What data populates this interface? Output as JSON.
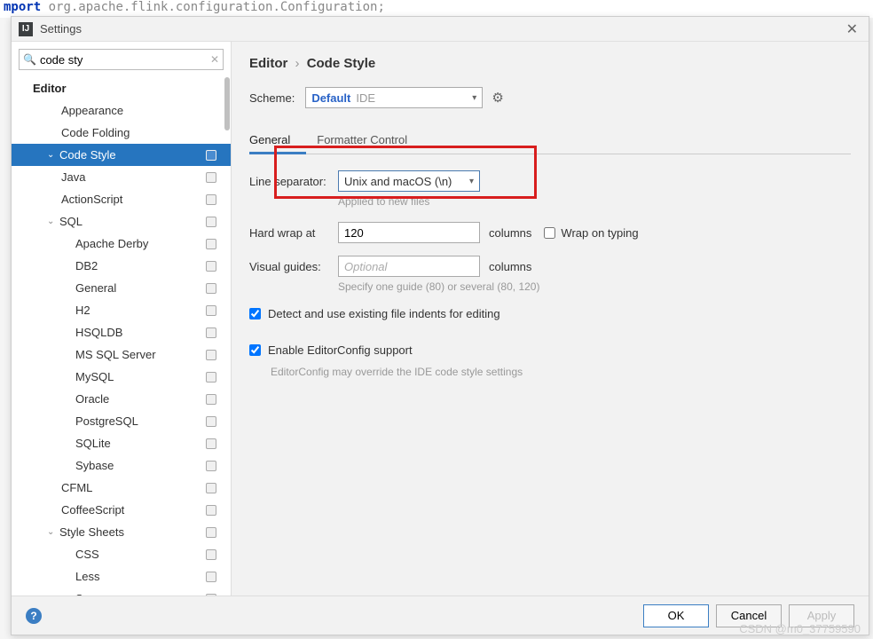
{
  "code_bg": {
    "keyword": "mport",
    "rest": " org.apache.flink.configuration.Configuration;"
  },
  "window": {
    "title": "Settings"
  },
  "search": {
    "value": "code sty"
  },
  "sidebar": {
    "header": "Editor",
    "items": [
      {
        "label": "Appearance",
        "cls": "pad-1",
        "scope": false
      },
      {
        "label": "Code Folding",
        "cls": "pad-1",
        "scope": false
      },
      {
        "label": "Code Style",
        "cls": "pad-2 selected",
        "expand": "⌄",
        "scope": true
      },
      {
        "label": "Java",
        "cls": "pad-1",
        "scope": true
      },
      {
        "label": "ActionScript",
        "cls": "pad-1",
        "scope": true
      },
      {
        "label": "SQL",
        "cls": "pad-2",
        "expand": "⌄",
        "scope": true
      },
      {
        "label": "Apache Derby",
        "cls": "pad-3",
        "scope": true
      },
      {
        "label": "DB2",
        "cls": "pad-3",
        "scope": true
      },
      {
        "label": "General",
        "cls": "pad-3",
        "scope": true
      },
      {
        "label": "H2",
        "cls": "pad-3",
        "scope": true
      },
      {
        "label": "HSQLDB",
        "cls": "pad-3",
        "scope": true
      },
      {
        "label": "MS SQL Server",
        "cls": "pad-3",
        "scope": true
      },
      {
        "label": "MySQL",
        "cls": "pad-3",
        "scope": true
      },
      {
        "label": "Oracle",
        "cls": "pad-3",
        "scope": true
      },
      {
        "label": "PostgreSQL",
        "cls": "pad-3",
        "scope": true
      },
      {
        "label": "SQLite",
        "cls": "pad-3",
        "scope": true
      },
      {
        "label": "Sybase",
        "cls": "pad-3",
        "scope": true
      },
      {
        "label": "CFML",
        "cls": "pad-1",
        "scope": true
      },
      {
        "label": "CoffeeScript",
        "cls": "pad-1",
        "scope": true
      },
      {
        "label": "Style Sheets",
        "cls": "pad-2",
        "expand": "⌄",
        "scope": true
      },
      {
        "label": "CSS",
        "cls": "pad-3",
        "scope": true
      },
      {
        "label": "Less",
        "cls": "pad-3",
        "scope": true
      },
      {
        "label": "Sass",
        "cls": "pad-3",
        "scope": true
      }
    ]
  },
  "breadcrumb": {
    "p1": "Editor",
    "sep": "›",
    "p2": "Code Style"
  },
  "scheme": {
    "label": "Scheme:",
    "value_main": "Default",
    "value_sub": "IDE"
  },
  "tabs": {
    "general": "General",
    "formatter": "Formatter Control"
  },
  "form": {
    "line_sep_label": "Line separator:",
    "line_sep_value": "Unix and macOS (\\n)",
    "line_sep_note": "Applied to new files",
    "hard_wrap_label": "Hard wrap at",
    "hard_wrap_value": "120",
    "columns_suffix": "columns",
    "wrap_on_typing": "Wrap on typing",
    "visual_guides_label": "Visual guides:",
    "visual_guides_placeholder": "Optional",
    "visual_guides_note": "Specify one guide (80) or several (80, 120)",
    "detect_indents": "Detect and use existing file indents for editing",
    "enable_editorconfig": "Enable EditorConfig support",
    "ec_note": "EditorConfig may override the IDE code style settings"
  },
  "buttons": {
    "ok": "OK",
    "cancel": "Cancel",
    "apply": "Apply"
  },
  "watermark": "CSDN @m0_37759590"
}
